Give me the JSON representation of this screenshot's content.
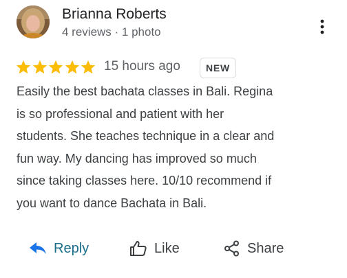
{
  "review": {
    "author": "Brianna Roberts",
    "author_meta": "4 reviews · 1 photo",
    "rating": 5,
    "rating_max": 5,
    "time_ago": "15 hours ago",
    "badge": "NEW",
    "text_lines": [
      "Easily the best bachata classes in Bali. Regina",
      "is so professional and patient with her",
      "students. She teaches technique in a clear and",
      "fun way. My dancing has improved so much",
      "since taking classes here. 10/10 recommend if",
      "you want to dance Bachata in Bali."
    ]
  },
  "actions": {
    "reply_label": "Reply",
    "like_label": "Like",
    "share_label": "Share"
  },
  "icons": {
    "star": "star-icon",
    "more": "more-vert-icon",
    "reply": "reply-arrow-icon",
    "like": "thumb-up-icon",
    "share": "share-icon"
  },
  "colors": {
    "star": "#fbbc04",
    "reply_icon": "#1a73e8",
    "reply_text": "#1a6e89",
    "text": "#3c4043",
    "muted": "#5f6368"
  }
}
